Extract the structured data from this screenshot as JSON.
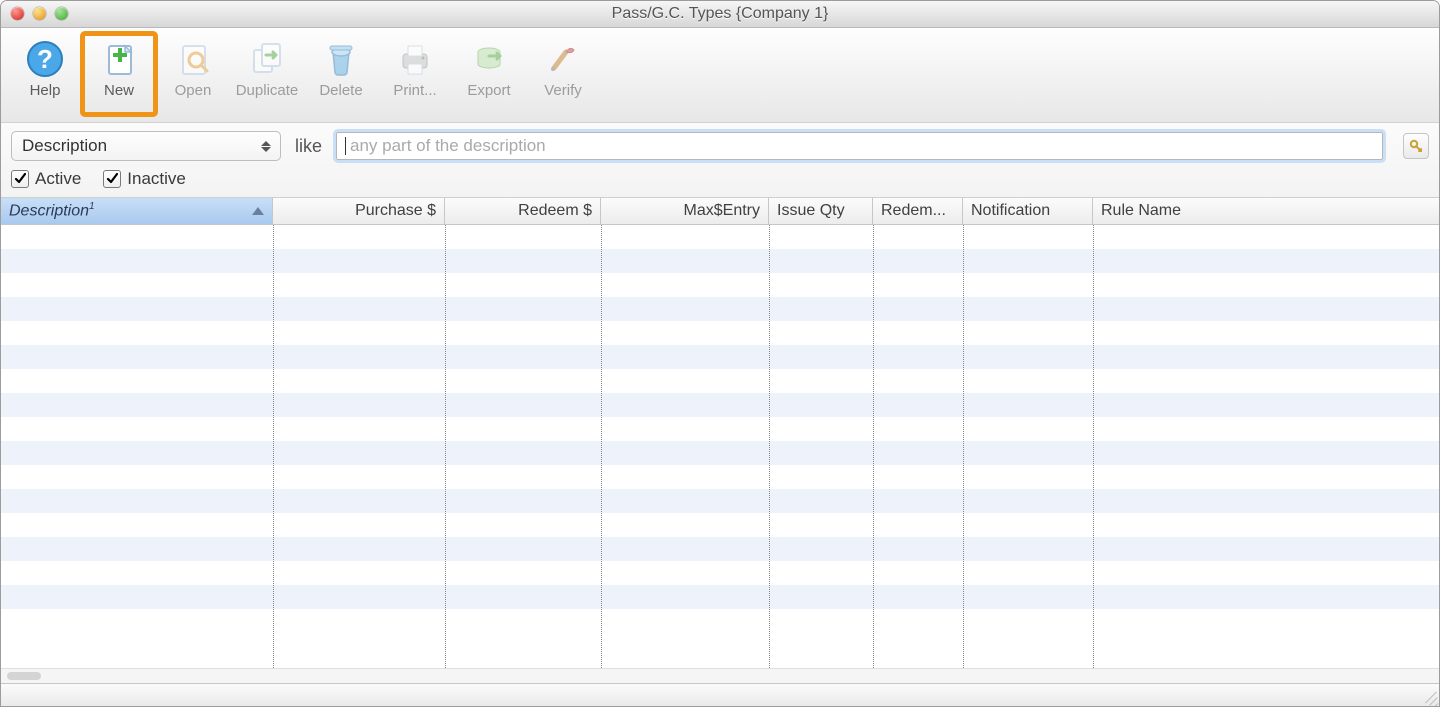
{
  "window": {
    "title": "Pass/G.C. Types {Company 1}"
  },
  "toolbar": {
    "items": [
      {
        "name": "help",
        "label": "Help",
        "icon": "help-icon",
        "disabled": false
      },
      {
        "name": "new",
        "label": "New",
        "icon": "new-icon",
        "disabled": false,
        "highlighted": true
      },
      {
        "name": "open",
        "label": "Open",
        "icon": "open-icon",
        "disabled": true
      },
      {
        "name": "duplicate",
        "label": "Duplicate",
        "icon": "duplicate-icon",
        "disabled": true
      },
      {
        "name": "delete",
        "label": "Delete",
        "icon": "delete-icon",
        "disabled": true
      },
      {
        "name": "print",
        "label": "Print...",
        "icon": "print-icon",
        "disabled": true
      },
      {
        "name": "export",
        "label": "Export",
        "icon": "export-icon",
        "disabled": true
      },
      {
        "name": "verify",
        "label": "Verify",
        "icon": "verify-icon",
        "disabled": true
      }
    ]
  },
  "filter": {
    "field_selected": "Description",
    "operator_label": "like",
    "search_placeholder": "any part of the description",
    "search_value": "",
    "active_label": "Active",
    "inactive_label": "Inactive",
    "active_checked": true,
    "inactive_checked": true
  },
  "table": {
    "columns": [
      {
        "key": "description",
        "label": "Description",
        "sorted": true,
        "sort_index": "1",
        "align": "left",
        "width": "w-desc"
      },
      {
        "key": "purchase",
        "label": "Purchase $",
        "align": "right",
        "width": "w-purch"
      },
      {
        "key": "redeem",
        "label": "Redeem $",
        "align": "right",
        "width": "w-redeem"
      },
      {
        "key": "max_entry",
        "label": "Max$Entry",
        "align": "right",
        "width": "w-max"
      },
      {
        "key": "issue_qty",
        "label": "Issue Qty",
        "align": "left",
        "width": "w-issue"
      },
      {
        "key": "redemptions",
        "label": "Redem...",
        "align": "left",
        "width": "w-redm"
      },
      {
        "key": "notification",
        "label": "Notification",
        "align": "left",
        "width": "w-notif"
      },
      {
        "key": "rule_name",
        "label": "Rule Name",
        "align": "left",
        "width": "last"
      }
    ],
    "rows": [],
    "visible_row_slots": 17
  }
}
